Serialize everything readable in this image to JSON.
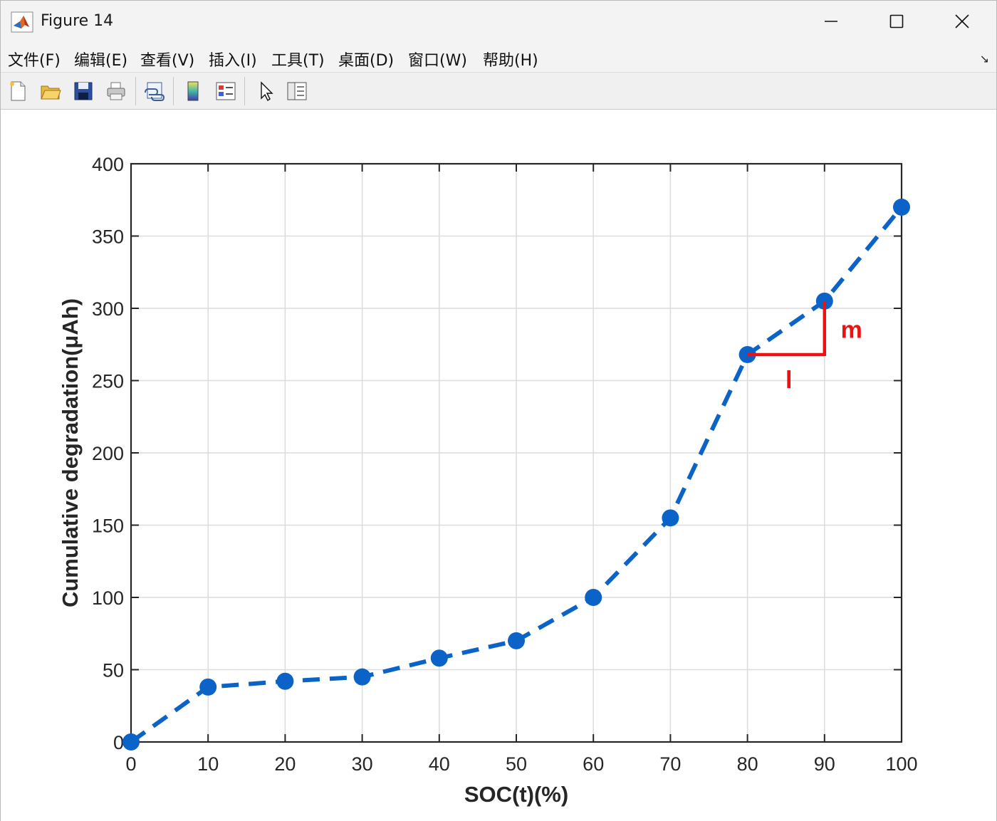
{
  "window": {
    "title": "Figure 14",
    "menu": [
      "文件(F)",
      "编辑(E)",
      "查看(V)",
      "插入(I)",
      "工具(T)",
      "桌面(D)",
      "窗口(W)",
      "帮助(H)"
    ],
    "toolbar_icons": [
      "new-figure-icon",
      "open-file-icon",
      "save-icon",
      "print-icon",
      "link-plot-icon",
      "colorbar-icon",
      "legend-icon",
      "pointer-icon",
      "property-inspector-icon"
    ]
  },
  "chart_data": {
    "type": "line",
    "xlabel": "SOC(t)(%)",
    "ylabel": "Cumulative degradation(μAh)",
    "xlim": [
      0,
      100
    ],
    "ylim": [
      0,
      400
    ],
    "xticks": [
      0,
      10,
      20,
      30,
      40,
      50,
      60,
      70,
      80,
      90,
      100
    ],
    "yticks": [
      0,
      50,
      100,
      150,
      200,
      250,
      300,
      350,
      400
    ],
    "grid": true,
    "series": [
      {
        "x": [
          0,
          10,
          20,
          30,
          40,
          50,
          60,
          70,
          80,
          90,
          100
        ],
        "y": [
          0,
          38,
          42,
          45,
          58,
          70,
          100,
          155,
          268,
          305,
          370
        ],
        "color": "#0b63c7",
        "line_style": "dashed",
        "marker": "circle"
      }
    ],
    "annotation": {
      "color": "#ee1111",
      "horizontal": {
        "from": [
          80,
          268
        ],
        "to": [
          90,
          268
        ],
        "label": "l"
      },
      "vertical": {
        "from": [
          90,
          268
        ],
        "to": [
          90,
          305
        ],
        "label": "m"
      }
    }
  }
}
